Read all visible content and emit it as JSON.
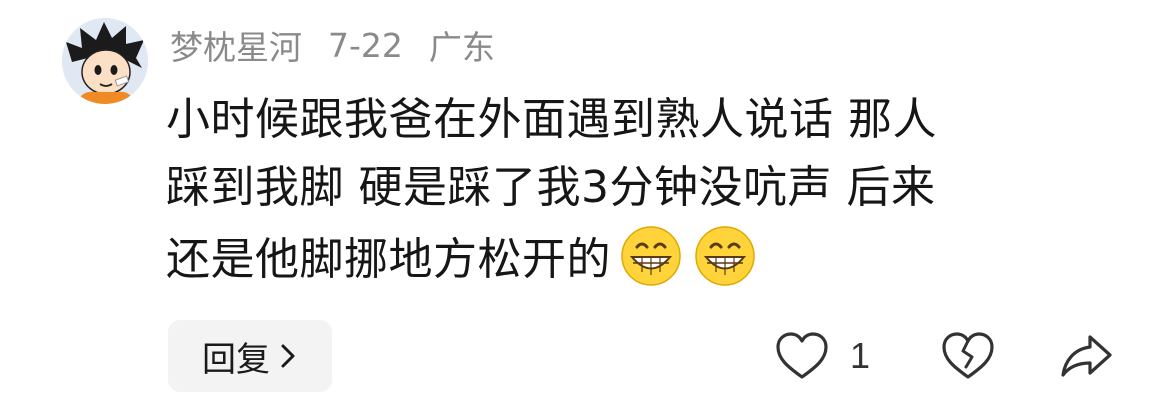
{
  "comment": {
    "author": "梦枕星河",
    "date": "7-22",
    "location": "广东",
    "text_lines": [
      "小时候跟我爸在外面遇到熟人说话 那人",
      "踩到我脚 硬是踩了我3分钟没吭声 后来",
      "还是他脚挪地方松开的"
    ],
    "emojis": [
      "grin-emoji",
      "grin-emoji"
    ]
  },
  "actions": {
    "reply_label": "回复",
    "like_count": "1",
    "icons": {
      "like": "heart-outline-icon",
      "dislike": "broken-heart-icon",
      "share": "share-arrow-icon",
      "reply_chevron": "chevron-right-icon"
    }
  },
  "colors": {
    "meta_text": "#8a8a8a",
    "body_text": "#161616",
    "reply_bg": "#f3f3f3",
    "icon_stroke": "#333333",
    "emoji_face": "#ffd43b"
  }
}
